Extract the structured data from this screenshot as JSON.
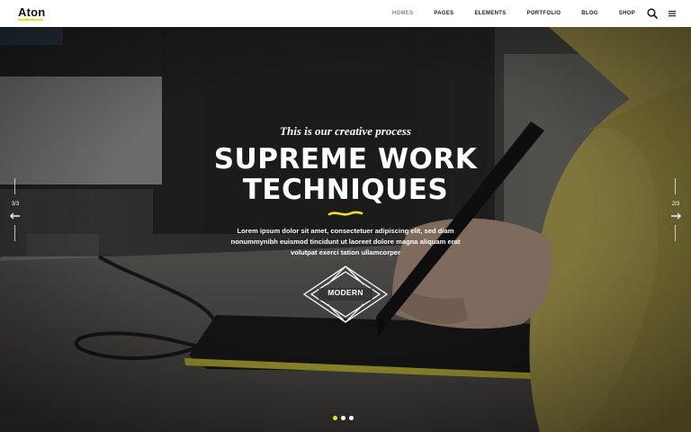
{
  "header": {
    "logo": "Aton",
    "nav": [
      {
        "label": "HOMES",
        "active": true
      },
      {
        "label": "PAGES",
        "active": false
      },
      {
        "label": "ELEMENTS",
        "active": false
      },
      {
        "label": "PORTFOLIO",
        "active": false
      },
      {
        "label": "BLOG",
        "active": false
      },
      {
        "label": "SHOP",
        "active": false
      }
    ],
    "icons": [
      "search-icon",
      "hamburger-menu-icon"
    ]
  },
  "hero": {
    "tagline": "This is our creative process",
    "title_line1": "SUPREME WORK",
    "title_line2": "TECHNIQUES",
    "description_line1": "Lorem ipsum dolor sit amet, consectetuer adipiscing elit, sed diam",
    "description_line2": "nonummynibh euismod tincidunt ut laoreet dolore magna aliquam erat",
    "description_line3": "volutpat exerci tation ullamcorper",
    "badge_label": "MODERN",
    "left_counter": "3/3",
    "right_counter": "2/3",
    "slides_total": 3,
    "active_slide": 1
  },
  "colors": {
    "accent": "#f2e01a",
    "header_bg": "#ffffff",
    "text_light": "#ffffff"
  }
}
